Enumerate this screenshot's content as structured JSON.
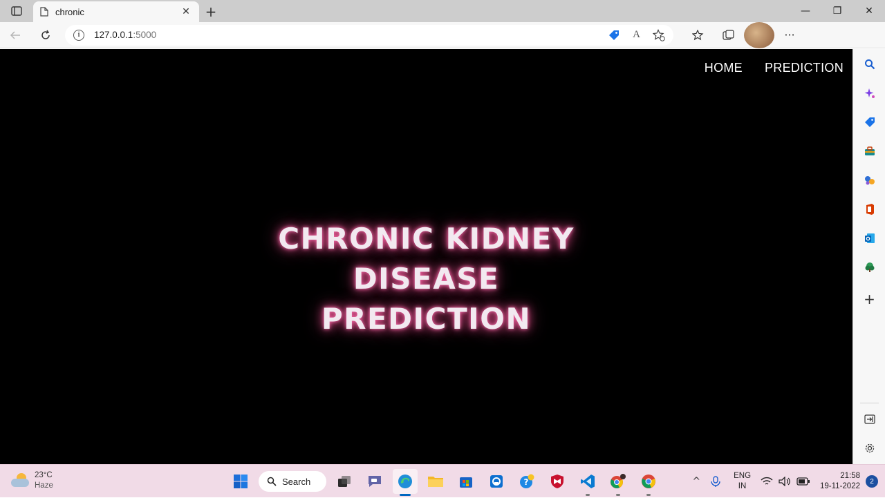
{
  "browser": {
    "tab": {
      "title": "chronic",
      "close": "✕"
    },
    "new_tab": "+",
    "window_controls": {
      "minimize": "—",
      "restore": "❐",
      "close": "✕"
    },
    "address": {
      "host": "127.0.0.1",
      "port": ":5000"
    }
  },
  "page": {
    "nav": [
      {
        "label": "HOME"
      },
      {
        "label": "PREDICTION"
      }
    ],
    "hero_line1": "CHRONIC KIDNEY DISEASE",
    "hero_line2": "PREDICTION"
  },
  "taskbar": {
    "weather": {
      "temp": "23°C",
      "condition": "Haze"
    },
    "search_label": "Search",
    "lang": {
      "line1": "ENG",
      "line2": "IN"
    },
    "clock": {
      "time": "21:58",
      "date": "19-11-2022"
    },
    "notification_count": "2"
  }
}
